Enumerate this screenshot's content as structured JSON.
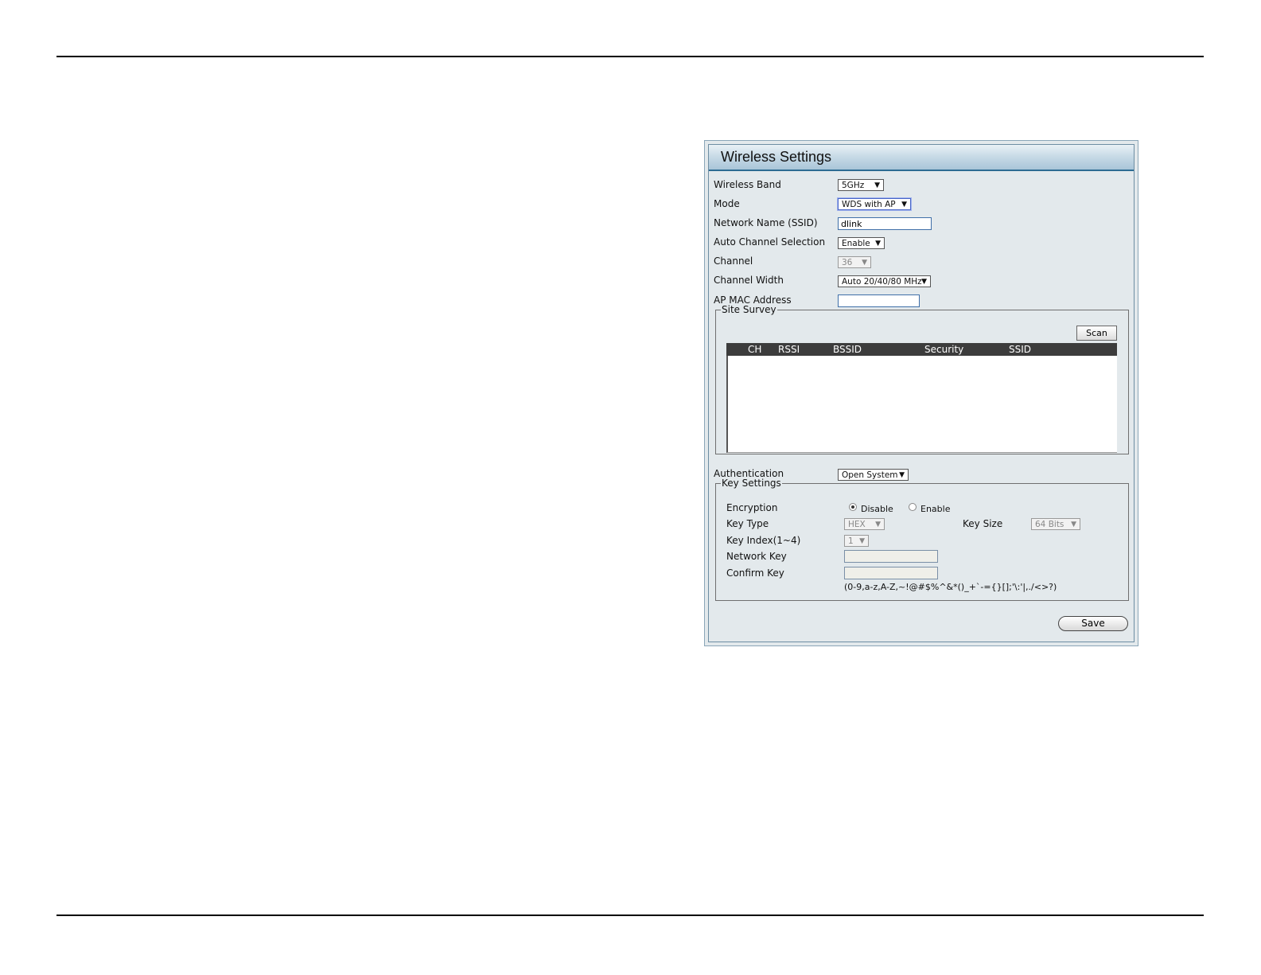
{
  "panel": {
    "title": "Wireless Settings"
  },
  "fields": {
    "wireless_band": {
      "label": "Wireless Band",
      "value": "5GHz"
    },
    "mode": {
      "label": "Mode",
      "value": "WDS with AP"
    },
    "ssid": {
      "label": "Network Name (SSID)",
      "value": "dlink"
    },
    "auto_channel": {
      "label": "Auto Channel Selection",
      "value": "Enable"
    },
    "channel": {
      "label": "Channel",
      "value": "36"
    },
    "channel_width": {
      "label": "Channel Width",
      "value": "Auto 20/40/80 MHz"
    },
    "ap_mac": {
      "label": "AP MAC Address",
      "value": ""
    },
    "authentication": {
      "label": "Authentication",
      "value": "Open System"
    }
  },
  "site_survey": {
    "legend": "Site Survey",
    "scan_label": "Scan",
    "columns": [
      "CH",
      "RSSI",
      "BSSID",
      "Security",
      "SSID"
    ]
  },
  "key_settings": {
    "legend": "Key Settings",
    "encryption_label": "Encryption",
    "encryption_disable": "Disable",
    "encryption_enable": "Enable",
    "key_type_label": "Key Type",
    "key_type_value": "HEX",
    "key_size_label": "Key Size",
    "key_size_value": "64 Bits",
    "key_index_label": "Key Index(1~4)",
    "key_index_value": "1",
    "network_key_label": "Network Key",
    "confirm_key_label": "Confirm Key",
    "allowed_chars": "(0-9,a-z,A-Z,~!@#$%^&*()_+`-={}[];'\\:'|,./<>?)"
  },
  "save_label": "Save",
  "icons": {
    "dropdown": "chevron-down-icon"
  }
}
